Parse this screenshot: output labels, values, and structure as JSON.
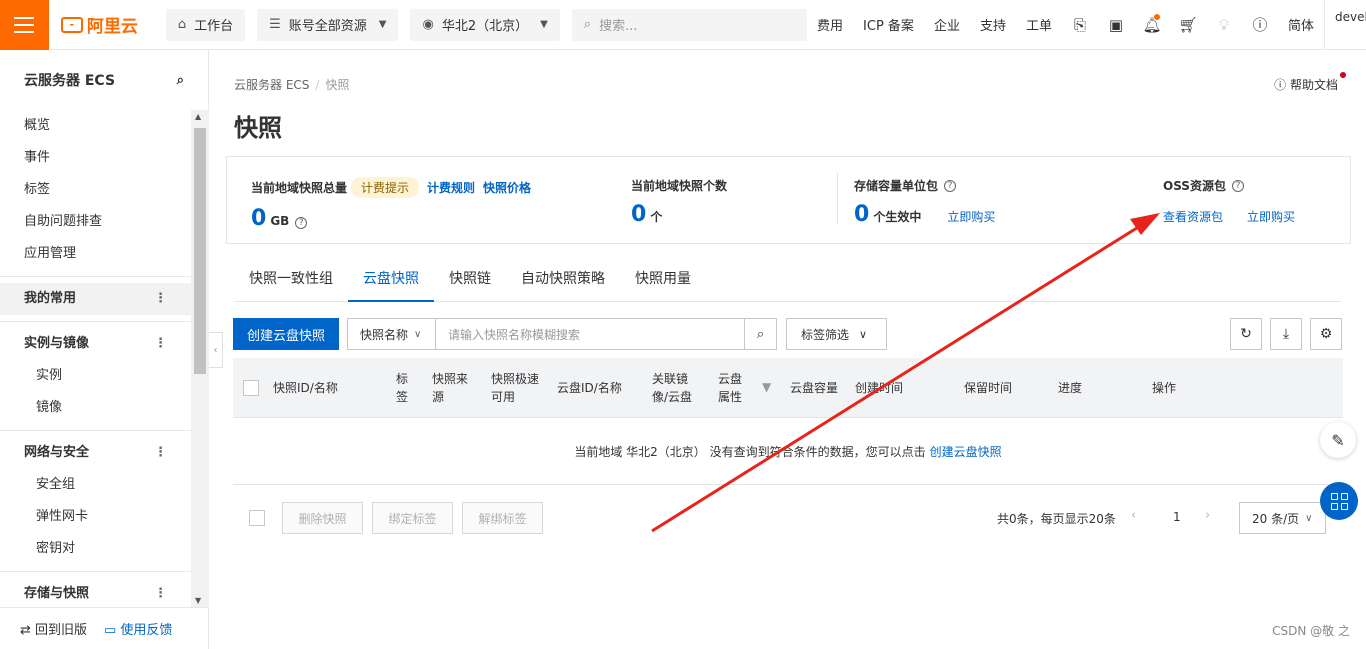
{
  "topbar": {
    "workbench": "工作台",
    "all_resources": "账号全部资源",
    "region": "华北2（北京）",
    "search_placeholder": "搜索...",
    "links": [
      "费用",
      "ICP 备案",
      "企业",
      "支持",
      "工单"
    ],
    "language": "简体",
    "user": "devel"
  },
  "logo": {
    "text": "阿里云"
  },
  "sidebar": {
    "title": "云服务器 ECS",
    "items": {
      "overview": "概览",
      "events": "事件",
      "tags": "标签",
      "troubleshoot": "自助问题排查",
      "app_mgmt": "应用管理",
      "favorites": "我的常用",
      "group_instances": "实例与镜像",
      "instances": "实例",
      "images": "镜像",
      "group_network": "网络与安全",
      "security_group": "安全组",
      "eni": "弹性网卡",
      "keypair": "密钥对",
      "group_storage": "存储与快照"
    },
    "footer": {
      "old": "回到旧版",
      "feedback": "使用反馈"
    }
  },
  "breadcrumb": {
    "root": "云服务器 ECS",
    "sep": "/",
    "current": "快照"
  },
  "help": "帮助文档",
  "page_title": "快照",
  "summary": {
    "total_label": "当前地域快照总量",
    "billing_tip": "计费提示",
    "billing_rules": "计费规则",
    "snapshot_price": "快照价格",
    "total_value": "0",
    "total_unit": "GB",
    "count_label": "当前地域快照个数",
    "count_value": "0",
    "count_unit": "个",
    "storage_label": "存储容量单位包",
    "storage_value": "0",
    "storage_unit": "个生效中",
    "buy_now": "立即购买",
    "oss_label": "OSS资源包",
    "view_packages": "查看资源包",
    "oss_buy": "立即购买"
  },
  "tabs": [
    "快照一致性组",
    "云盘快照",
    "快照链",
    "自动快照策略",
    "快照用量"
  ],
  "toolbar": {
    "create": "创建云盘快照",
    "filter_field": "快照名称",
    "search_placeholder": "请输入快照名称模糊搜索",
    "tag_filter": "标签筛选"
  },
  "table": {
    "headers": [
      "快照ID/名称",
      "标签",
      "快照来源",
      "快照极速可用",
      "云盘ID/名称",
      "关联镜像/云盘",
      "云盘属性",
      "云盘容量",
      "创建时间",
      "保留时间",
      "进度",
      "操作"
    ],
    "empty_prefix": "当前地域 华北2（北京） 没有查询到符合条件的数据，您可以点击",
    "empty_link": "创建云盘快照"
  },
  "batch": {
    "delete": "删除快照",
    "bind_tag": "绑定标签",
    "unbind_tag": "解绑标签"
  },
  "pagination": {
    "summary": "共0条，每页显示20条",
    "page": "1",
    "page_size": "20 条/页"
  },
  "watermark": "CSDN @敬 之",
  "colors": {
    "brand": "#ff6a00",
    "primary": "#0064c8",
    "annotation_arrow": "#e8231c"
  }
}
